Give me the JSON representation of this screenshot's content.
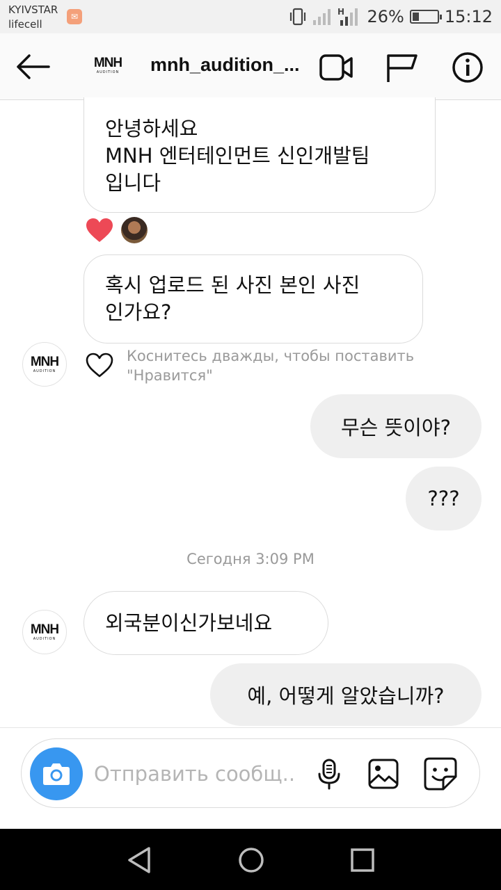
{
  "status_bar": {
    "carrier_1": "KYIVSTAR",
    "carrier_2": "lifecell",
    "battery_percent": "26%",
    "battery_level": 0.26,
    "time": "15:12",
    "icons": [
      "vibrate-icon",
      "signal-icon",
      "signal-h-icon",
      "battery-icon"
    ]
  },
  "header": {
    "title": "mnh_audition_...",
    "avatar_logo": "MNH",
    "avatar_sub": "AUDITION",
    "icons": [
      "back-arrow-icon",
      "video-call-icon",
      "flag-icon",
      "info-icon"
    ]
  },
  "messages": [
    {
      "direction": "incoming",
      "lines": [
        "안녕하세요",
        "MNH 엔터테인먼트 신인개발팀",
        "입니다"
      ],
      "reactions": [
        "heart-reaction-icon",
        "reactor-avatar"
      ]
    },
    {
      "direction": "incoming",
      "lines": [
        "혹시 업로드 된 사진 본인 사진",
        "인가요?"
      ]
    },
    {
      "direction": "outgoing",
      "text": "무슨 뜻이야?"
    },
    {
      "direction": "outgoing",
      "text": "???"
    },
    {
      "direction": "incoming",
      "text": "외국분이신가보네요"
    },
    {
      "direction": "outgoing",
      "text": "예, 어떻게 알았습니까?"
    }
  ],
  "like_hint": {
    "line_1": "Коснитесь дважды, чтобы поставить",
    "line_2": "\"Нравится\""
  },
  "timestamp": "Сегодня 3:09 PM",
  "composer": {
    "placeholder": "Отправить сообщ...",
    "icons": [
      "camera-icon",
      "microphone-icon",
      "gallery-icon",
      "sticker-icon"
    ]
  },
  "nav_bar": {
    "icons": [
      "nav-back-icon",
      "nav-home-icon",
      "nav-recents-icon"
    ]
  },
  "colors": {
    "accent": "#3897f0",
    "heart": "#ed4956",
    "outgoing_bubble": "#efefef",
    "border": "#dbdbdb"
  }
}
